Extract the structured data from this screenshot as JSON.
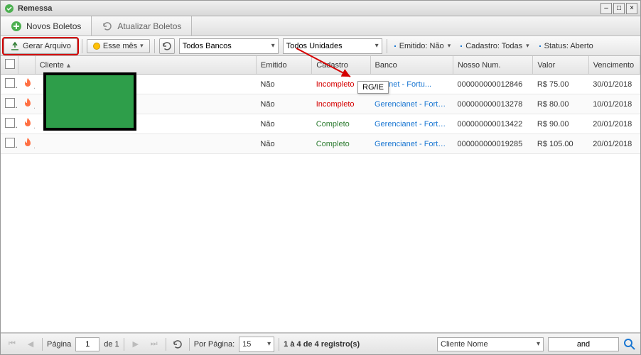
{
  "window": {
    "title": "Remessa"
  },
  "tabs": {
    "novos": "Novos Boletos",
    "atualizar": "Atualizar Boletos"
  },
  "toolbar": {
    "gerar": "Gerar Arquivo",
    "period": "Esse mês",
    "bancos": "Todos Bancos",
    "unidades": "Todos Unidades",
    "filter_emitido": "Emitido: Não",
    "filter_cadastro": "Cadastro: Todas",
    "filter_status": "Status: Aberto"
  },
  "columns": {
    "cliente": "Cliente",
    "emitido": "Emitido",
    "cadastro": "Cadastro",
    "banco": "Banco",
    "nosso_num": "Nosso Num.",
    "valor": "Valor",
    "vencimento": "Vencimento"
  },
  "rows": [
    {
      "emitido": "Não",
      "cadastro": "Incompleto",
      "cadastro_class": "incomplete",
      "banco": "ncianet - Fortu...",
      "banco_full": "Gerencianet - Fortu...",
      "nosso_num": "000000000012846",
      "valor": "R$ 75.00",
      "venc": "30/01/2018"
    },
    {
      "emitido": "Não",
      "cadastro": "Incompleto",
      "cadastro_class": "incomplete",
      "banco": "Gerencianet - Fortu...",
      "banco_full": "Gerencianet - Fortu...",
      "nosso_num": "000000000013278",
      "valor": "R$ 80.00",
      "venc": "10/01/2018"
    },
    {
      "emitido": "Não",
      "cadastro": "Completo",
      "cadastro_class": "complete",
      "banco": "Gerencianet - Fortu...",
      "banco_full": "Gerencianet - Fortu...",
      "nosso_num": "000000000013422",
      "valor": "R$ 90.00",
      "venc": "20/01/2018"
    },
    {
      "emitido": "Não",
      "cadastro": "Completo",
      "cadastro_class": "complete",
      "banco": "Gerencianet - Fortu...",
      "banco_full": "Gerencianet - Fortu...",
      "nosso_num": "000000000019285",
      "valor": "R$ 105.00",
      "venc": "20/01/2018"
    }
  ],
  "tooltip_text": "RG/IE",
  "pager": {
    "page_label": "Página",
    "page_value": "1",
    "of_label": "de 1",
    "per_page_label": "Por Página:",
    "per_page_value": "15",
    "summary": "1 à 4 de 4 registro(s)",
    "search_field": "Cliente Nome",
    "search_op": "and"
  }
}
